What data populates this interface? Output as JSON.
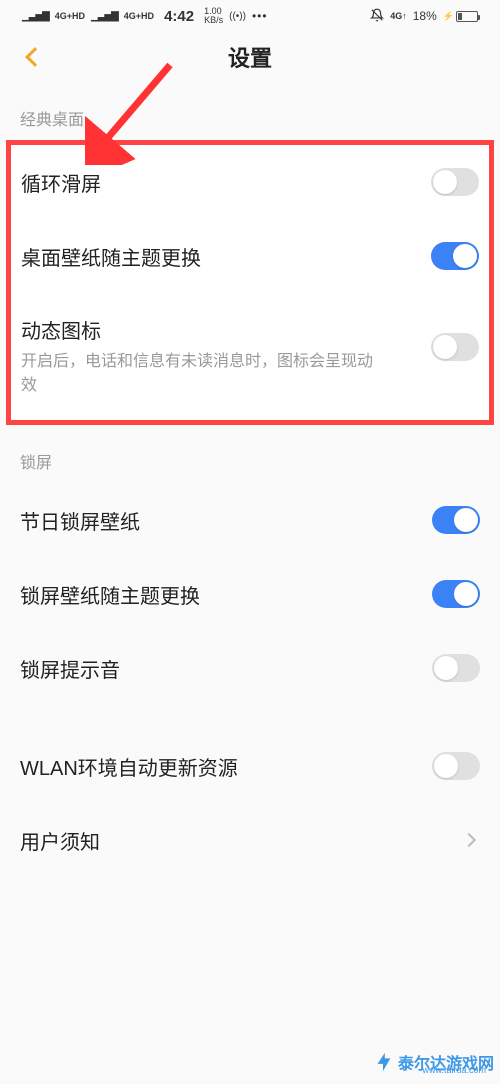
{
  "status_bar": {
    "net1": "4G+HD",
    "net2": "4G+HD",
    "time": "4:42",
    "speed_num": "1.00",
    "speed_unit": "KB/s",
    "wifi_signal": "((•))",
    "dots": "•••",
    "net_indicator": "4G↑",
    "battery_pct": "18%",
    "charging": "⚡"
  },
  "header": {
    "title": "设置"
  },
  "section1": {
    "title": "经典桌面",
    "items": [
      {
        "label": "循环滑屏",
        "on": false
      },
      {
        "label": "桌面壁纸随主题更换",
        "on": true
      },
      {
        "label": "动态图标",
        "desc": "开启后，电话和信息有未读消息时，图标会呈现动效",
        "on": false
      }
    ]
  },
  "section2": {
    "title": "锁屏",
    "items": [
      {
        "label": "节日锁屏壁纸",
        "on": true
      },
      {
        "label": "锁屏壁纸随主题更换",
        "on": true
      },
      {
        "label": "锁屏提示音",
        "on": false
      }
    ]
  },
  "section3": {
    "items": [
      {
        "label": "WLAN环境自动更新资源",
        "on": false
      },
      {
        "label": "用户须知",
        "type": "link"
      }
    ]
  },
  "watermark": {
    "text": "泰尔达游戏网",
    "url": "www.tairda.com"
  },
  "colors": {
    "accent_orange": "#f5a623",
    "toggle_on": "#3b82f6",
    "highlight_red": "#ff4444"
  }
}
